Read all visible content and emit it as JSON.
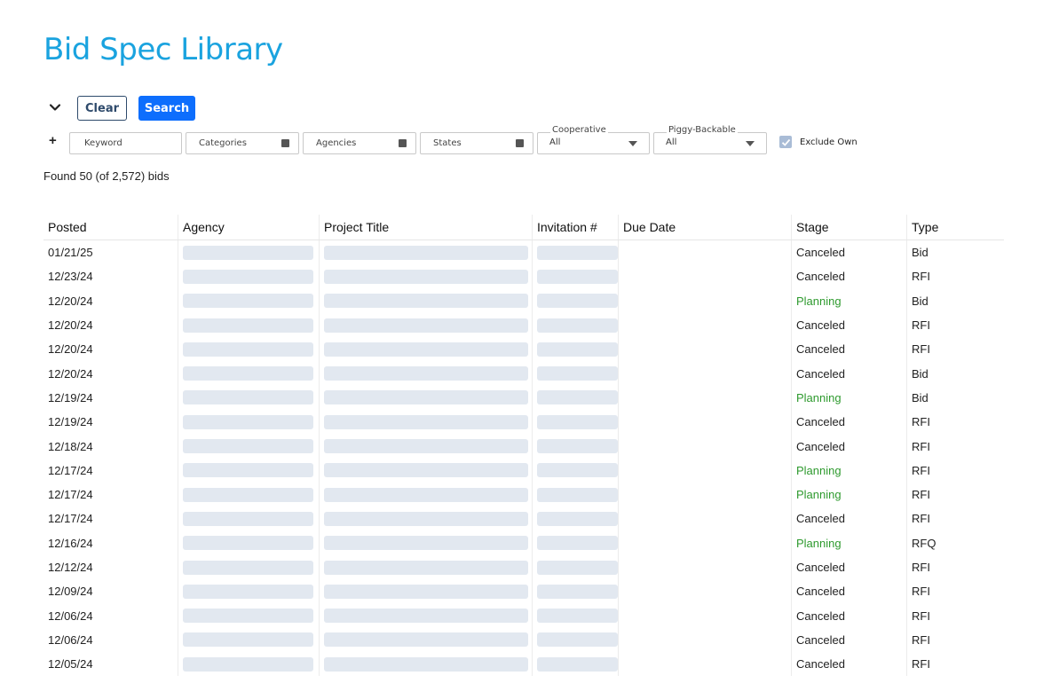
{
  "page": {
    "title": "Bid Spec Library"
  },
  "toolbar": {
    "clear_label": "Clear",
    "search_label": "Search",
    "expand_icon": "chevron-down-icon",
    "add_icon": "plus-icon"
  },
  "filters": {
    "keyword_placeholder": "Keyword",
    "categories_label": "Categories",
    "agencies_label": "Agencies",
    "states_label": "States",
    "cooperative": {
      "label": "Cooperative",
      "value": "All"
    },
    "piggyback": {
      "label": "Piggy-Backable",
      "value": "All"
    },
    "exclude_own": {
      "label": "Exclude Own",
      "checked": true
    }
  },
  "results": {
    "summary": "Found 50 (of 2,572) bids"
  },
  "table": {
    "columns": [
      "Posted",
      "Agency",
      "Project Title",
      "Invitation #",
      "Due Date",
      "Stage",
      "Type"
    ],
    "rows": [
      {
        "posted": "01/21/25",
        "stage": "Canceled",
        "type": "Bid"
      },
      {
        "posted": "12/23/24",
        "stage": "Canceled",
        "type": "RFI"
      },
      {
        "posted": "12/20/24",
        "stage": "Planning",
        "type": "Bid"
      },
      {
        "posted": "12/20/24",
        "stage": "Canceled",
        "type": "RFI"
      },
      {
        "posted": "12/20/24",
        "stage": "Canceled",
        "type": "RFI"
      },
      {
        "posted": "12/20/24",
        "stage": "Canceled",
        "type": "Bid"
      },
      {
        "posted": "12/19/24",
        "stage": "Planning",
        "type": "Bid"
      },
      {
        "posted": "12/19/24",
        "stage": "Canceled",
        "type": "RFI"
      },
      {
        "posted": "12/18/24",
        "stage": "Canceled",
        "type": "RFI"
      },
      {
        "posted": "12/17/24",
        "stage": "Planning",
        "type": "RFI"
      },
      {
        "posted": "12/17/24",
        "stage": "Planning",
        "type": "RFI"
      },
      {
        "posted": "12/17/24",
        "stage": "Canceled",
        "type": "RFI"
      },
      {
        "posted": "12/16/24",
        "stage": "Planning",
        "type": "RFQ"
      },
      {
        "posted": "12/12/24",
        "stage": "Canceled",
        "type": "RFI"
      },
      {
        "posted": "12/09/24",
        "stage": "Canceled",
        "type": "RFI"
      },
      {
        "posted": "12/06/24",
        "stage": "Canceled",
        "type": "RFI"
      },
      {
        "posted": "12/06/24",
        "stage": "Canceled",
        "type": "RFI"
      },
      {
        "posted": "12/05/24",
        "stage": "Canceled",
        "type": "RFI"
      }
    ]
  },
  "colors": {
    "title": "#1aa3df",
    "primary_button": "#0d6efd",
    "planning": "#2e9a2e",
    "placeholder_bar": "#e2e8f0"
  }
}
